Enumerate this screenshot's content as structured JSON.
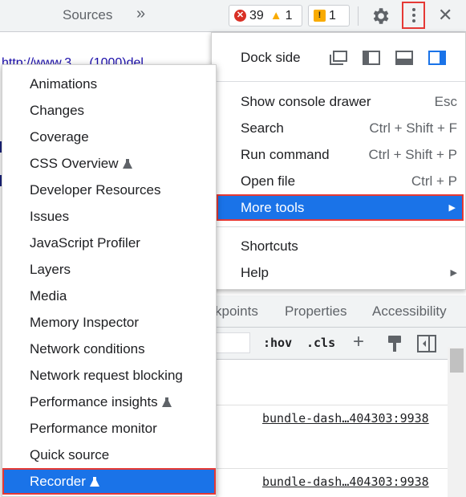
{
  "toolbar": {
    "tab_sources": "Sources",
    "more_tabs": "»",
    "errors_count": "39",
    "warnings_count": "1",
    "issues_count": "1",
    "close": "✕"
  },
  "background": {
    "url_fragment": "http://www.3.....(1000)del",
    "styles_tabs": [
      "kpoints",
      "Properties",
      "Accessibility"
    ],
    "styles_toolbar": {
      "hov": ":hov",
      "cls": ".cls",
      "plus": "+"
    },
    "sources": [
      "bundle-dash…404303:9938",
      "bundle-dash…404303:9938"
    ]
  },
  "main_menu": {
    "dock_side_label": "Dock side",
    "items": [
      {
        "label": "Show console drawer",
        "shortcut": "Esc"
      },
      {
        "label": "Search",
        "shortcut": "Ctrl + Shift + F"
      },
      {
        "label": "Run command",
        "shortcut": "Ctrl + Shift + P"
      },
      {
        "label": "Open file",
        "shortcut": "Ctrl + P"
      },
      {
        "label": "More tools",
        "shortcut": ""
      },
      {
        "label": "Shortcuts",
        "shortcut": ""
      },
      {
        "label": "Help",
        "shortcut": ""
      }
    ]
  },
  "more_tools_menu": {
    "items": [
      {
        "label": "Animations"
      },
      {
        "label": "Changes"
      },
      {
        "label": "Coverage"
      },
      {
        "label": "CSS Overview"
      },
      {
        "label": "Developer Resources"
      },
      {
        "label": "Issues"
      },
      {
        "label": "JavaScript Profiler"
      },
      {
        "label": "Layers"
      },
      {
        "label": "Media"
      },
      {
        "label": "Memory Inspector"
      },
      {
        "label": "Network conditions"
      },
      {
        "label": "Network request blocking"
      },
      {
        "label": "Performance insights"
      },
      {
        "label": "Performance monitor"
      },
      {
        "label": "Quick source"
      },
      {
        "label": "Recorder"
      }
    ]
  },
  "colors": {
    "accent": "#1a73e8",
    "highlight_border": "#e53935"
  }
}
